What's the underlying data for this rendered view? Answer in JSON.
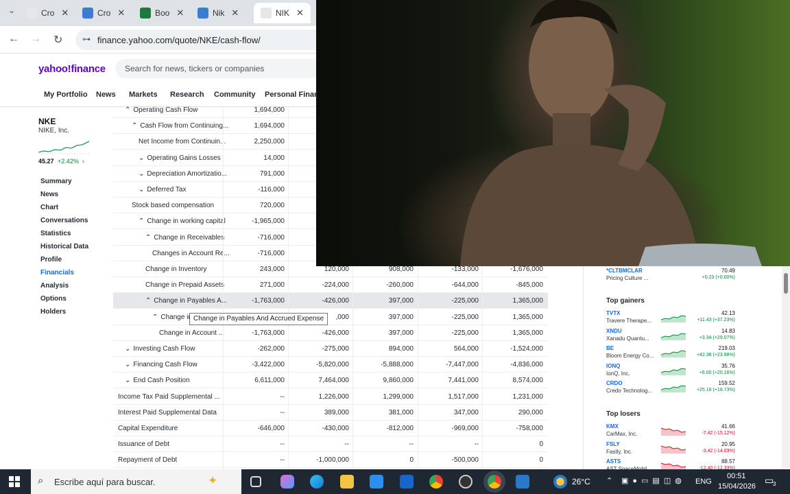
{
  "browser": {
    "tabs": [
      {
        "icon": "yahoo-tab-icon",
        "label": "Cro",
        "color": "#e6e6e6"
      },
      {
        "icon": "seekingalpha-tab-icon",
        "label": "Cro",
        "color": "#3a7bd5"
      },
      {
        "icon": "excel-tab-icon",
        "label": "Boo",
        "color": "#1d7a3e"
      },
      {
        "icon": "seekingalpha-tab-icon",
        "label": "Nik",
        "color": "#3a7bd5"
      },
      {
        "icon": "yahoo-tab-icon",
        "label": "NIK",
        "color": "#e6e6e6"
      }
    ],
    "url": "finance.yahoo.com/quote/NKE/cash-flow/"
  },
  "header": {
    "logo": "yahoo!finance",
    "search_placeholder": "Search for news, tickers or companies",
    "nav": [
      "My Portfolio",
      "News",
      "Markets",
      "Research",
      "Community",
      "Personal Finance"
    ]
  },
  "quote": {
    "ticker": "NKE",
    "company": "NIKE, Inc.",
    "price": "45.27",
    "change": "+2.42%"
  },
  "sidebar": {
    "items": [
      "Summary",
      "News",
      "Chart",
      "Conversations",
      "Statistics",
      "Historical Data",
      "Profile",
      "Financials",
      "Analysis",
      "Options",
      "Holders"
    ],
    "active_index": 7
  },
  "table": {
    "rows": [
      {
        "label": "Operating Cash Flow",
        "prefix": "⌃",
        "indent": 1,
        "values": [
          "1,694,000",
          "",
          "",
          "",
          ""
        ]
      },
      {
        "label": "Cash Flow from Continuing...",
        "prefix": "⌃",
        "indent": 2,
        "values": [
          "1,694,000",
          "",
          "",
          "",
          ""
        ]
      },
      {
        "label": "Net Income from Continuin...",
        "prefix": "",
        "indent": 3,
        "values": [
          "2,250,000",
          "",
          "",
          "",
          ""
        ]
      },
      {
        "label": "Operating Gains Losses",
        "prefix": "⌄",
        "indent": 3,
        "values": [
          "14,000",
          "",
          "",
          "",
          ""
        ]
      },
      {
        "label": "Depreciation Amortizatio...",
        "prefix": "⌄",
        "indent": 3,
        "values": [
          "791,000",
          "",
          "",
          "",
          ""
        ]
      },
      {
        "label": "Deferred Tax",
        "prefix": "⌄",
        "indent": 3,
        "values": [
          "-116,000",
          "",
          "",
          "",
          ""
        ]
      },
      {
        "label": "Stock based compensation",
        "prefix": "",
        "indent": 2,
        "values": [
          "720,000",
          "",
          "",
          "",
          ""
        ]
      },
      {
        "label": "Change in working capital",
        "prefix": "⌃",
        "indent": 3,
        "values": [
          "-1,965,000",
          "",
          "",
          "",
          ""
        ]
      },
      {
        "label": "Change in Receivables",
        "prefix": "⌃",
        "indent": 4,
        "values": [
          "-716,000",
          "",
          "",
          "",
          ""
        ]
      },
      {
        "label": "Changes in Account Re...",
        "prefix": "",
        "indent": 5,
        "values": [
          "-716,000",
          "",
          "",
          "",
          ""
        ]
      },
      {
        "label": "Change in Inventory",
        "prefix": "",
        "indent": 4,
        "values": [
          "243,000",
          "120,000",
          "908,000",
          "-133,000",
          "-1,676,000"
        ]
      },
      {
        "label": "Change in Prepaid Assets",
        "prefix": "",
        "indent": 4,
        "values": [
          "271,000",
          "-224,000",
          "-260,000",
          "-644,000",
          "-845,000"
        ]
      },
      {
        "label": "Change in Payables A...",
        "prefix": "⌃",
        "indent": 4,
        "values": [
          "-1,763,000",
          "-426,000",
          "397,000",
          "-225,000",
          "1,365,000"
        ]
      },
      {
        "label": "Change in P",
        "prefix": "⌃",
        "indent": 5,
        "values": [
          "",
          ",000",
          "397,000",
          "-225,000",
          "1,365,000"
        ]
      },
      {
        "label": "Change in Account ...",
        "prefix": "",
        "indent": 6,
        "values": [
          "-1,763,000",
          "-426,000",
          "397,000",
          "-225,000",
          "1,365,000"
        ]
      },
      {
        "label": "Investing Cash Flow",
        "prefix": "⌄",
        "indent": 1,
        "values": [
          "-262,000",
          "-275,000",
          "894,000",
          "564,000",
          "-1,524,000"
        ]
      },
      {
        "label": "Financing Cash Flow",
        "prefix": "⌄",
        "indent": 1,
        "values": [
          "-3,422,000",
          "-5,820,000",
          "-5,888,000",
          "-7,447,000",
          "-4,836,000"
        ]
      },
      {
        "label": "End Cash Position",
        "prefix": "⌄",
        "indent": 1,
        "values": [
          "6,611,000",
          "7,464,000",
          "9,860,000",
          "7,441,000",
          "8,574,000"
        ]
      },
      {
        "label": "Income Tax Paid Supplemental ...",
        "prefix": "",
        "indent": 0,
        "values": [
          "--",
          "1,226,000",
          "1,299,000",
          "1,517,000",
          "1,231,000"
        ]
      },
      {
        "label": "Interest Paid Supplemental Data",
        "prefix": "",
        "indent": 0,
        "values": [
          "--",
          "389,000",
          "381,000",
          "347,000",
          "290,000"
        ]
      },
      {
        "label": "Capital Expenditure",
        "prefix": "",
        "indent": 0,
        "values": [
          "-646,000",
          "-430,000",
          "-812,000",
          "-969,000",
          "-758,000"
        ]
      },
      {
        "label": "Issuance of Debt",
        "prefix": "",
        "indent": 0,
        "values": [
          "--",
          "--",
          "--",
          "--",
          "0"
        ]
      },
      {
        "label": "Repayment of Debt",
        "prefix": "",
        "indent": 0,
        "values": [
          "--",
          "-1,000,000",
          "0",
          "-500,000",
          "0"
        ]
      }
    ],
    "highlight_index": 12,
    "tooltip": "Change in Payables And Accrued Expense"
  },
  "right_panel": {
    "top_item": {
      "symbol": "*CLTBMCLAR",
      "name": "Pricing Culture ...",
      "price": "70.49",
      "change": "+0.23 (+0.00%)"
    },
    "gainers_title": "Top gainers",
    "gainers": [
      {
        "symbol": "TVTX",
        "name": "Travere Therape...",
        "price": "42.13",
        "change": "+11.43 (+37.23%)"
      },
      {
        "symbol": "XNDU",
        "name": "Xanadu Quantu...",
        "price": "14.83",
        "change": "+3.34 (+29.07%)"
      },
      {
        "symbol": "BE",
        "name": "Bloom Energy Co...",
        "price": "219.03",
        "change": "+42.38 (+23.98%)"
      },
      {
        "symbol": "IONQ",
        "name": "IonQ, Inc.",
        "price": "35.76",
        "change": "+6.00 (+20.16%)"
      },
      {
        "symbol": "CRDO",
        "name": "Credo Technolog...",
        "price": "159.52",
        "change": "+25.16 (+18.73%)"
      }
    ],
    "losers_title": "Top losers",
    "losers": [
      {
        "symbol": "KMX",
        "name": "CarMax, Inc.",
        "price": "41.66",
        "change": "-7.42 (-15.12%)"
      },
      {
        "symbol": "FSLY",
        "name": "Fastly, Inc.",
        "price": "20.95",
        "change": "-3.42 (-14.03%)"
      },
      {
        "symbol": "ASTS",
        "name": "AST SpaceMobil...",
        "price": "88.57",
        "change": "-12.40 (-12.33%)"
      }
    ],
    "gain_color": "#008a3a",
    "loss_color": "#d60a22"
  },
  "taskbar": {
    "search_placeholder": "Escribe aquí para buscar.",
    "weather": "26°C",
    "language": "ENG",
    "time": "00:51",
    "date": "15/04/2026",
    "notifications": "3"
  }
}
